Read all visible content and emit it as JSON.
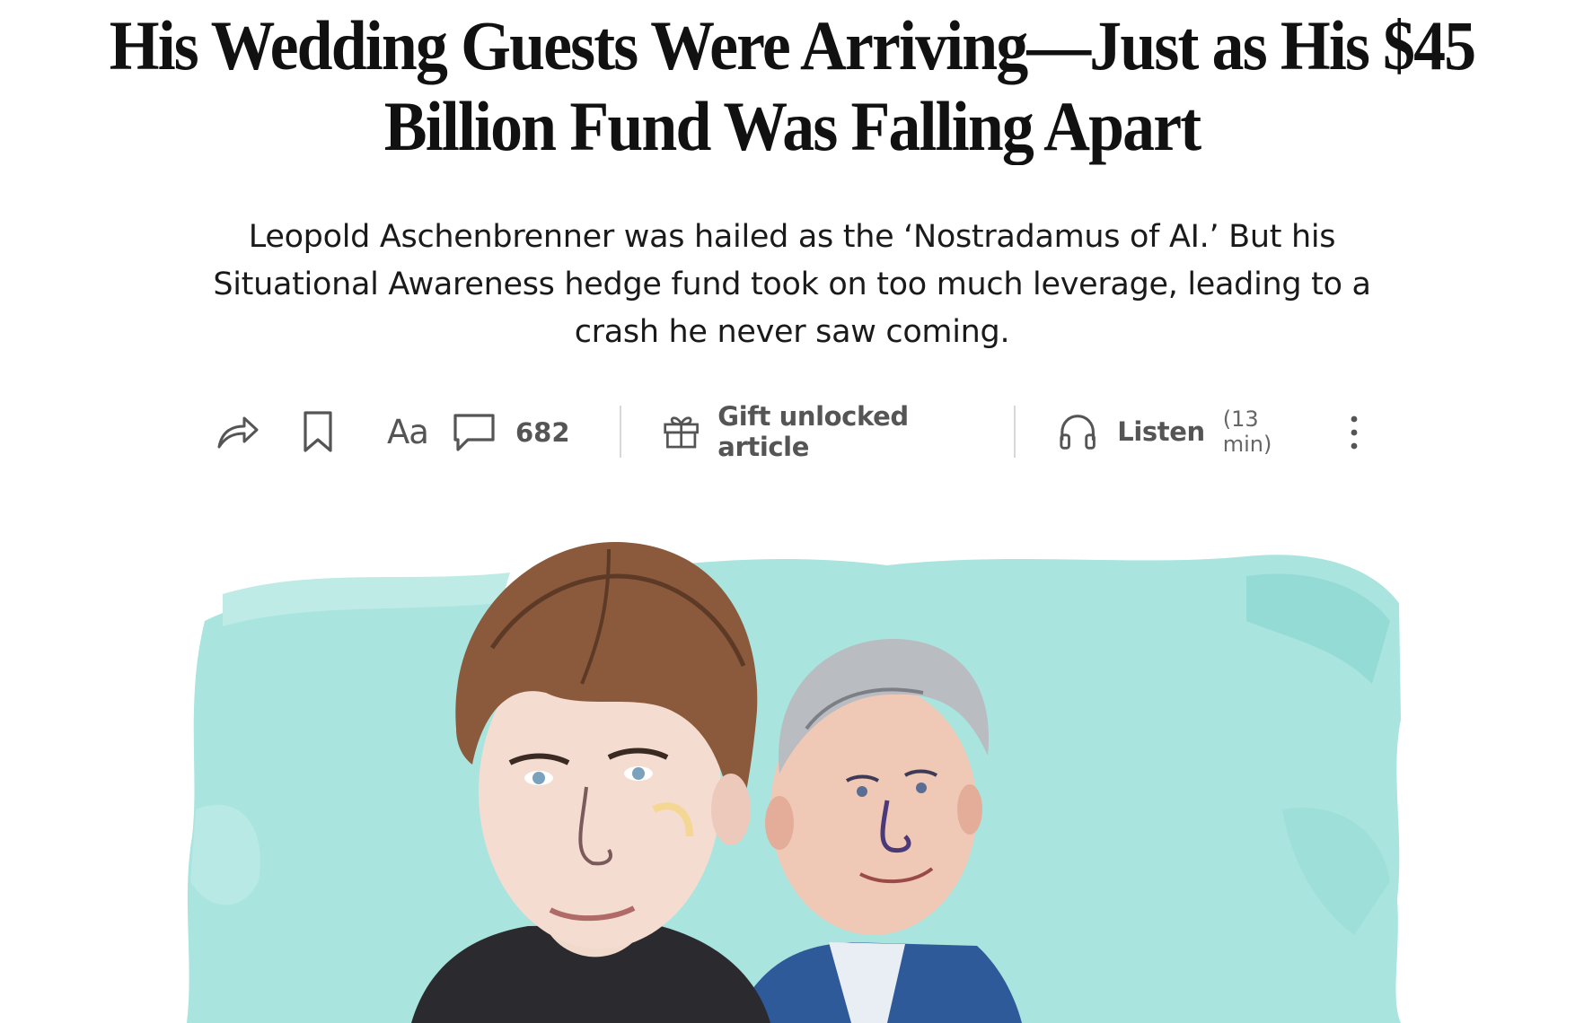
{
  "article": {
    "headline": "His Wedding Guests Were Arriving—Just as His $45 Billion Fund Was Falling Apart",
    "dek": "Leopold Aschenbrenner was hailed as the ‘Nostradamus of AI.’ But his Situational Awareness hedge fund took on too much leverage, leading to a crash he never saw coming."
  },
  "toolbar": {
    "text_size_label": "Aa",
    "comments_count": "682",
    "gift_label": "Gift unlocked article",
    "listen_label": "Listen",
    "listen_duration": "(13 min)",
    "icons": [
      "share-icon",
      "bookmark-icon",
      "text-size-icon",
      "comment-icon",
      "gift-icon",
      "headphones-icon",
      "more-vert-icon"
    ]
  },
  "colors": {
    "text": "#111111",
    "toolbar_gray": "#555555",
    "hero_background": "#a9e4df"
  }
}
